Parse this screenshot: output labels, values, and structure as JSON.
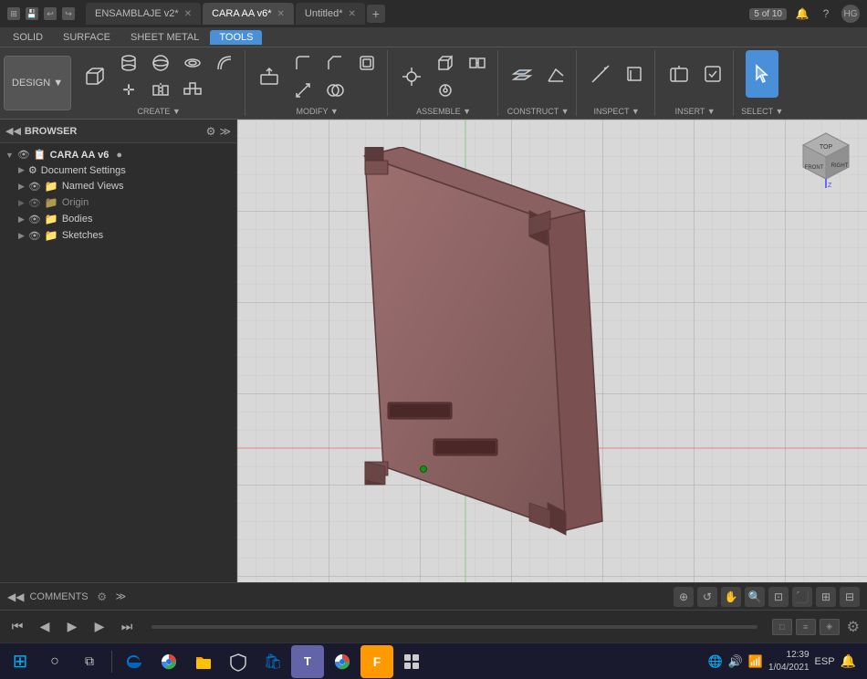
{
  "titlebar": {
    "tabs": [
      {
        "id": "ensamblaje",
        "label": "ENSAMBLAJE v2*",
        "active": false
      },
      {
        "id": "cara",
        "label": "CARA  AA v6*",
        "active": true
      },
      {
        "id": "untitled",
        "label": "Untitled*",
        "active": false
      }
    ],
    "badge": "5 of 10",
    "icons": [
      "grid-icon",
      "save-icon",
      "undo-icon",
      "redo-icon"
    ]
  },
  "toolbar": {
    "tabs": [
      "SOLID",
      "SURFACE",
      "SHEET METAL",
      "TOOLS"
    ],
    "active_tab": "TOOLS",
    "design_label": "DESIGN ▼",
    "groups": {
      "create": "CREATE ▼",
      "modify": "MODIFY ▼",
      "assemble": "ASSEMBLE ▼",
      "construct": "CONSTRUCT ▼",
      "inspect": "INSPECT ▼",
      "insert": "INSERT ▼",
      "select": "SELECT ▼"
    }
  },
  "browser": {
    "title": "BROWSER",
    "tree": {
      "root_label": "CARA  AA v6",
      "items": [
        {
          "label": "Document Settings",
          "has_children": true,
          "expanded": false
        },
        {
          "label": "Named Views",
          "has_children": true,
          "expanded": false
        },
        {
          "label": "Origin",
          "has_children": true,
          "expanded": false,
          "dim": true
        },
        {
          "label": "Bodies",
          "has_children": true,
          "expanded": false
        },
        {
          "label": "Sketches",
          "has_children": true,
          "expanded": false
        }
      ]
    }
  },
  "viewport": {
    "model_color": "#8B6B6B",
    "background_color": "#d8d8d8"
  },
  "bottom_bar": {
    "label": "COMMENTS",
    "view_icons": [
      "move-icon",
      "orbit-icon",
      "pan-icon",
      "zoom-icon",
      "fit-icon",
      "display-icon",
      "grid-toggle-icon",
      "visual-icon"
    ]
  },
  "anim_bar": {
    "controls": [
      "go-start",
      "prev",
      "play",
      "next",
      "go-end"
    ],
    "frame_controls": [
      "frame-box",
      "timeline-box",
      "keyframe-box"
    ]
  },
  "taskbar": {
    "icons": [
      {
        "id": "windows",
        "symbol": "⊞",
        "color": "#00adef"
      },
      {
        "id": "search",
        "symbol": "○",
        "color": "#ccc"
      },
      {
        "id": "task-view",
        "symbol": "⧉",
        "color": "#ccc"
      },
      {
        "id": "edge",
        "symbol": "e",
        "color": "#0078d4"
      },
      {
        "id": "chrome",
        "symbol": "◉",
        "color": "#4caf50"
      },
      {
        "id": "explorer",
        "symbol": "📁",
        "color": "#ffc107"
      },
      {
        "id": "security",
        "symbol": "🛡",
        "color": "#ccc"
      },
      {
        "id": "winstore",
        "symbol": "🛍",
        "color": "#0078d4"
      },
      {
        "id": "teams",
        "symbol": "T",
        "color": "#6264a7"
      },
      {
        "id": "chrome2",
        "symbol": "◉",
        "color": "#4caf50"
      },
      {
        "id": "fusion",
        "symbol": "F",
        "color": "#f90"
      },
      {
        "id": "app12",
        "symbol": "◆",
        "color": "#ccc"
      }
    ],
    "systray": {
      "lang": "ESP",
      "time": "12:39",
      "date": "1/04/2021"
    }
  }
}
